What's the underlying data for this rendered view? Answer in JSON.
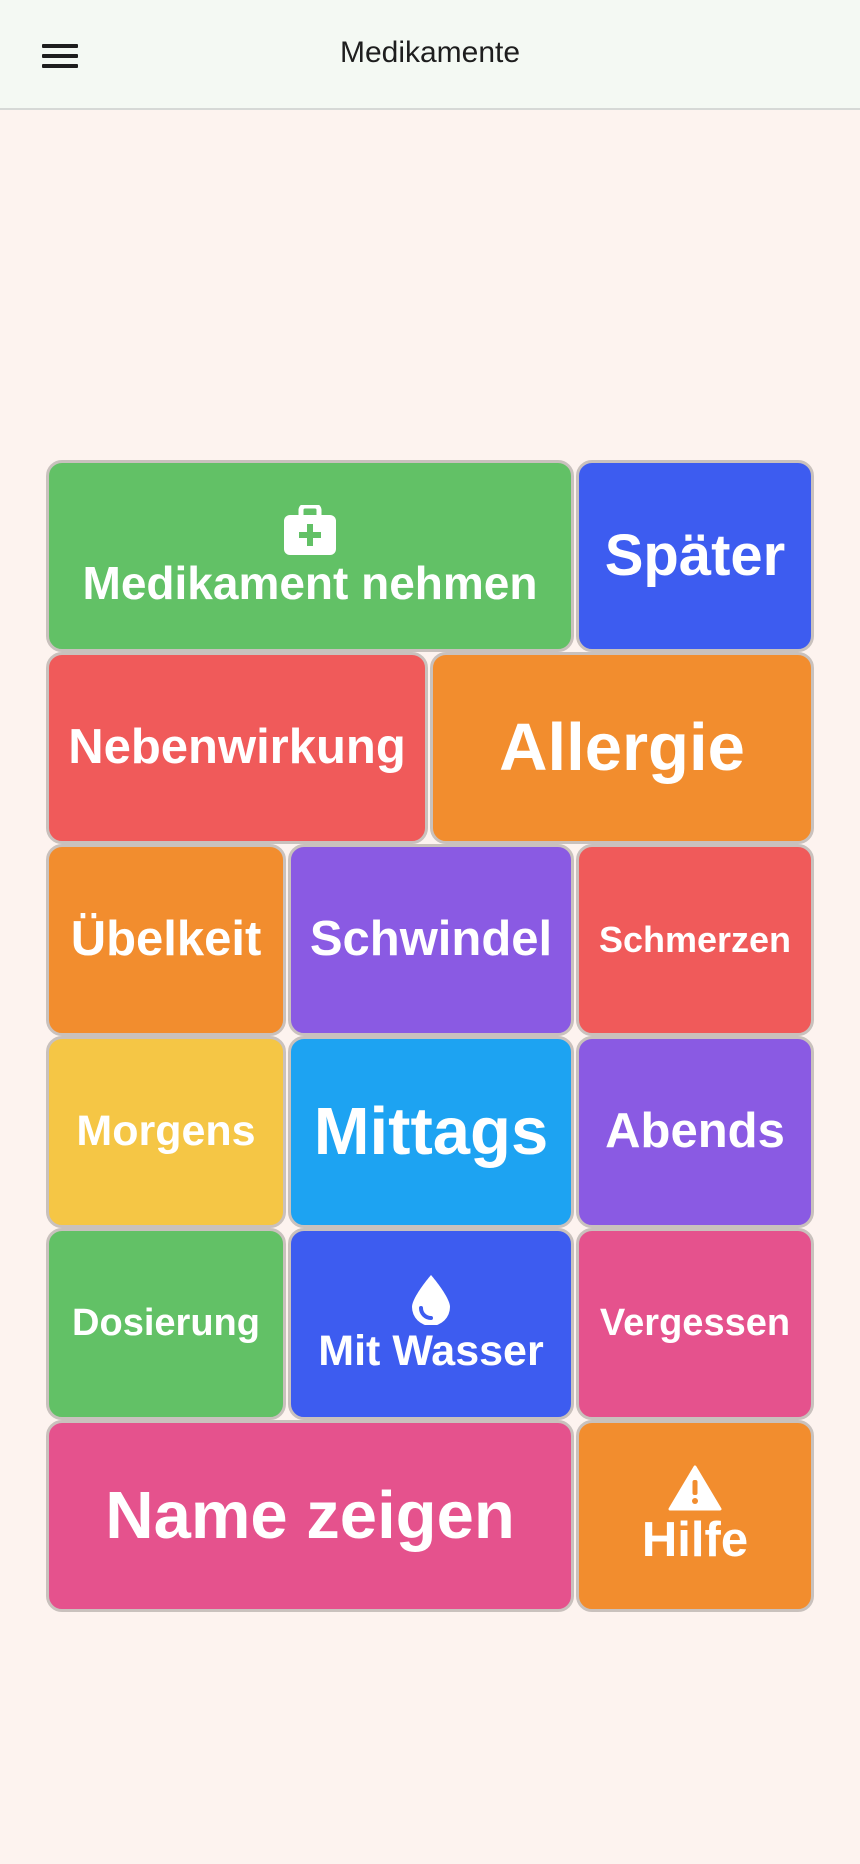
{
  "header": {
    "title": "Medikamente",
    "menu_icon": "hamburger-menu-icon"
  },
  "colors": {
    "green": "#62c166",
    "blue": "#3d5cf0",
    "red": "#f05a5a",
    "orange": "#f28d2e",
    "purple": "#8a5ae3",
    "yellow": "#f5c645",
    "sky": "#1da3f2",
    "pink": "#e5528d",
    "background": "#fdf3ef",
    "header_bg": "#f4f9f3"
  },
  "tiles": {
    "take_med": {
      "label": "Medikament nehmen",
      "icon": "medical-kit-icon"
    },
    "later": {
      "label": "Später"
    },
    "side_effect": {
      "label": "Nebenwirkung"
    },
    "allergy": {
      "label": "Allergie"
    },
    "nausea": {
      "label": "Übelkeit"
    },
    "dizziness": {
      "label": "Schwindel"
    },
    "pain": {
      "label": "Schmerzen"
    },
    "morning": {
      "label": "Morgens"
    },
    "noon": {
      "label": "Mittags"
    },
    "evening": {
      "label": "Abends"
    },
    "dosage": {
      "label": "Dosierung"
    },
    "with_water": {
      "label": "Mit Wasser",
      "icon": "water-drop-icon"
    },
    "forgot": {
      "label": "Vergessen"
    },
    "show_name": {
      "label": "Name zeigen"
    },
    "help": {
      "label": "Hilfe",
      "icon": "warning-icon"
    }
  }
}
